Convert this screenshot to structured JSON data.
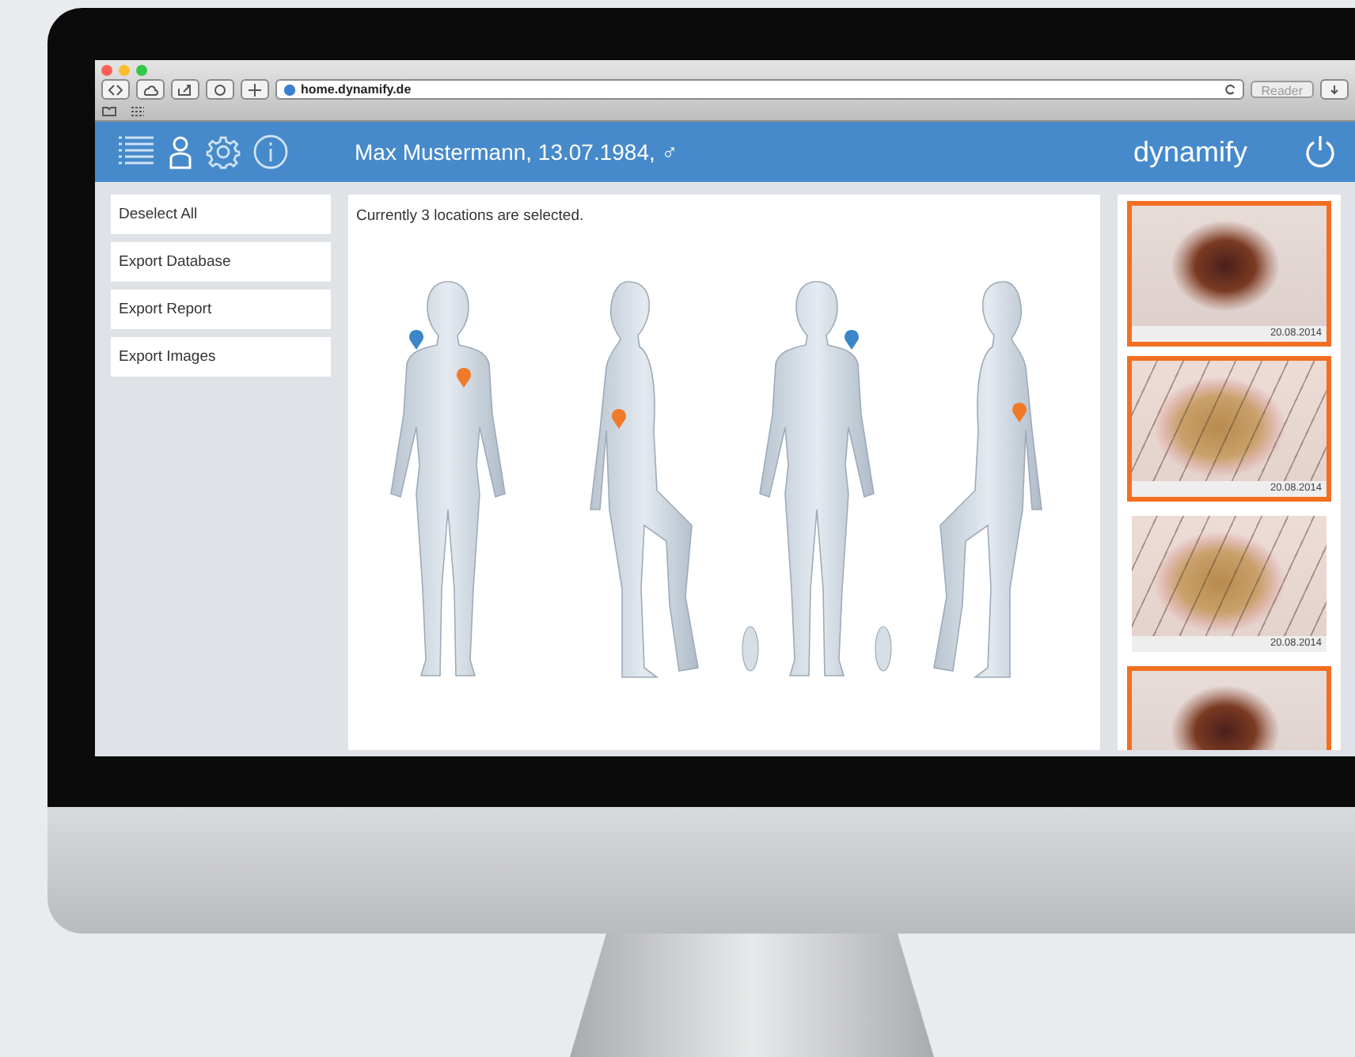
{
  "browser": {
    "url": "home.dynamify.de",
    "reader_button": "Reader"
  },
  "header": {
    "patient": "Max Mustermann, 13.07.1984, ♂",
    "brand": "dynamify"
  },
  "sidebar": {
    "buttons": [
      "Deselect All",
      "Export Database",
      "Export Report",
      "Export Images"
    ]
  },
  "body_map": {
    "status": "Currently 3 locations are selected.",
    "figures": [
      {
        "kind": "front",
        "markers": [
          {
            "color": "#3a86c8"
          },
          {
            "color": "#f07a2a"
          }
        ]
      },
      {
        "kind": "side",
        "markers": [
          {
            "color": "#f07a2a"
          }
        ]
      },
      {
        "kind": "back",
        "markers": [
          {
            "color": "#3a86c8"
          }
        ]
      },
      {
        "kind": "side_mirrored",
        "markers": [
          {
            "color": "#f07a2a"
          }
        ]
      }
    ]
  },
  "images": [
    {
      "date": "20.08.2014",
      "selected": true,
      "kind": "dark"
    },
    {
      "date": "20.08.2014",
      "selected": true,
      "kind": "hairy"
    },
    {
      "date": "20.08.2014",
      "selected": false,
      "kind": "hairy"
    },
    {
      "selected": true,
      "kind": "dark"
    }
  ]
}
